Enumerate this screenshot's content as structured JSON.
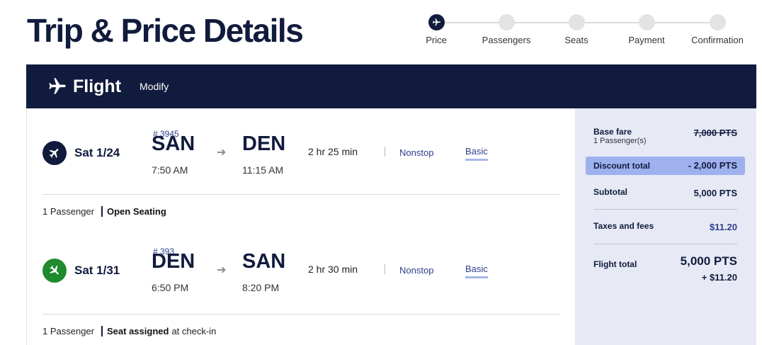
{
  "page": {
    "title": "Trip & Price Details"
  },
  "stepper": {
    "steps": [
      {
        "label": "Price",
        "active": true
      },
      {
        "label": "Passengers",
        "active": false
      },
      {
        "label": "Seats",
        "active": false
      },
      {
        "label": "Payment",
        "active": false
      },
      {
        "label": "Confirmation",
        "active": false
      }
    ]
  },
  "flight_bar": {
    "title": "Flight",
    "modify_label": "Modify"
  },
  "legs": [
    {
      "date": "Sat 1/24",
      "flight_number": "# 3945",
      "from_code": "SAN",
      "from_time": "7:50 AM",
      "to_code": "DEN",
      "to_time": "11:15 AM",
      "duration": "2 hr 25 min",
      "stops": "Nonstop",
      "fare_class": "Basic",
      "passengers": "1 Passenger",
      "seating": "Open Seating",
      "seating_suffix": "",
      "icon_color": "#111b3d"
    },
    {
      "date": "Sat 1/31",
      "flight_number": "# 393",
      "from_code": "DEN",
      "from_time": "6:50 PM",
      "to_code": "SAN",
      "to_time": "8:20 PM",
      "duration": "2 hr 30 min",
      "stops": "Nonstop",
      "fare_class": "Basic",
      "passengers": "1 Passenger",
      "seating": "Seat assigned",
      "seating_suffix": "at check-in",
      "icon_color": "#1f8a2e"
    }
  ],
  "summary": {
    "base_fare_label": "Base fare",
    "base_fare_sub": "1 Passenger(s)",
    "base_fare_value": "7,000 PTS",
    "discount_label": "Discount total",
    "discount_value": "- 2,000 PTS",
    "subtotal_label": "Subtotal",
    "subtotal_value": "5,000 PTS",
    "taxes_label": "Taxes and fees",
    "taxes_value": "$11.20",
    "total_label": "Flight total",
    "total_points": "5,000 PTS",
    "total_cash": "+ $11.20"
  },
  "colors": {
    "navy": "#111b3d",
    "accent_blue": "#2d3f8c",
    "green": "#1f8a2e",
    "sidebar_bg": "#e7eaf5",
    "discount_bg": "#9fb0ee"
  }
}
